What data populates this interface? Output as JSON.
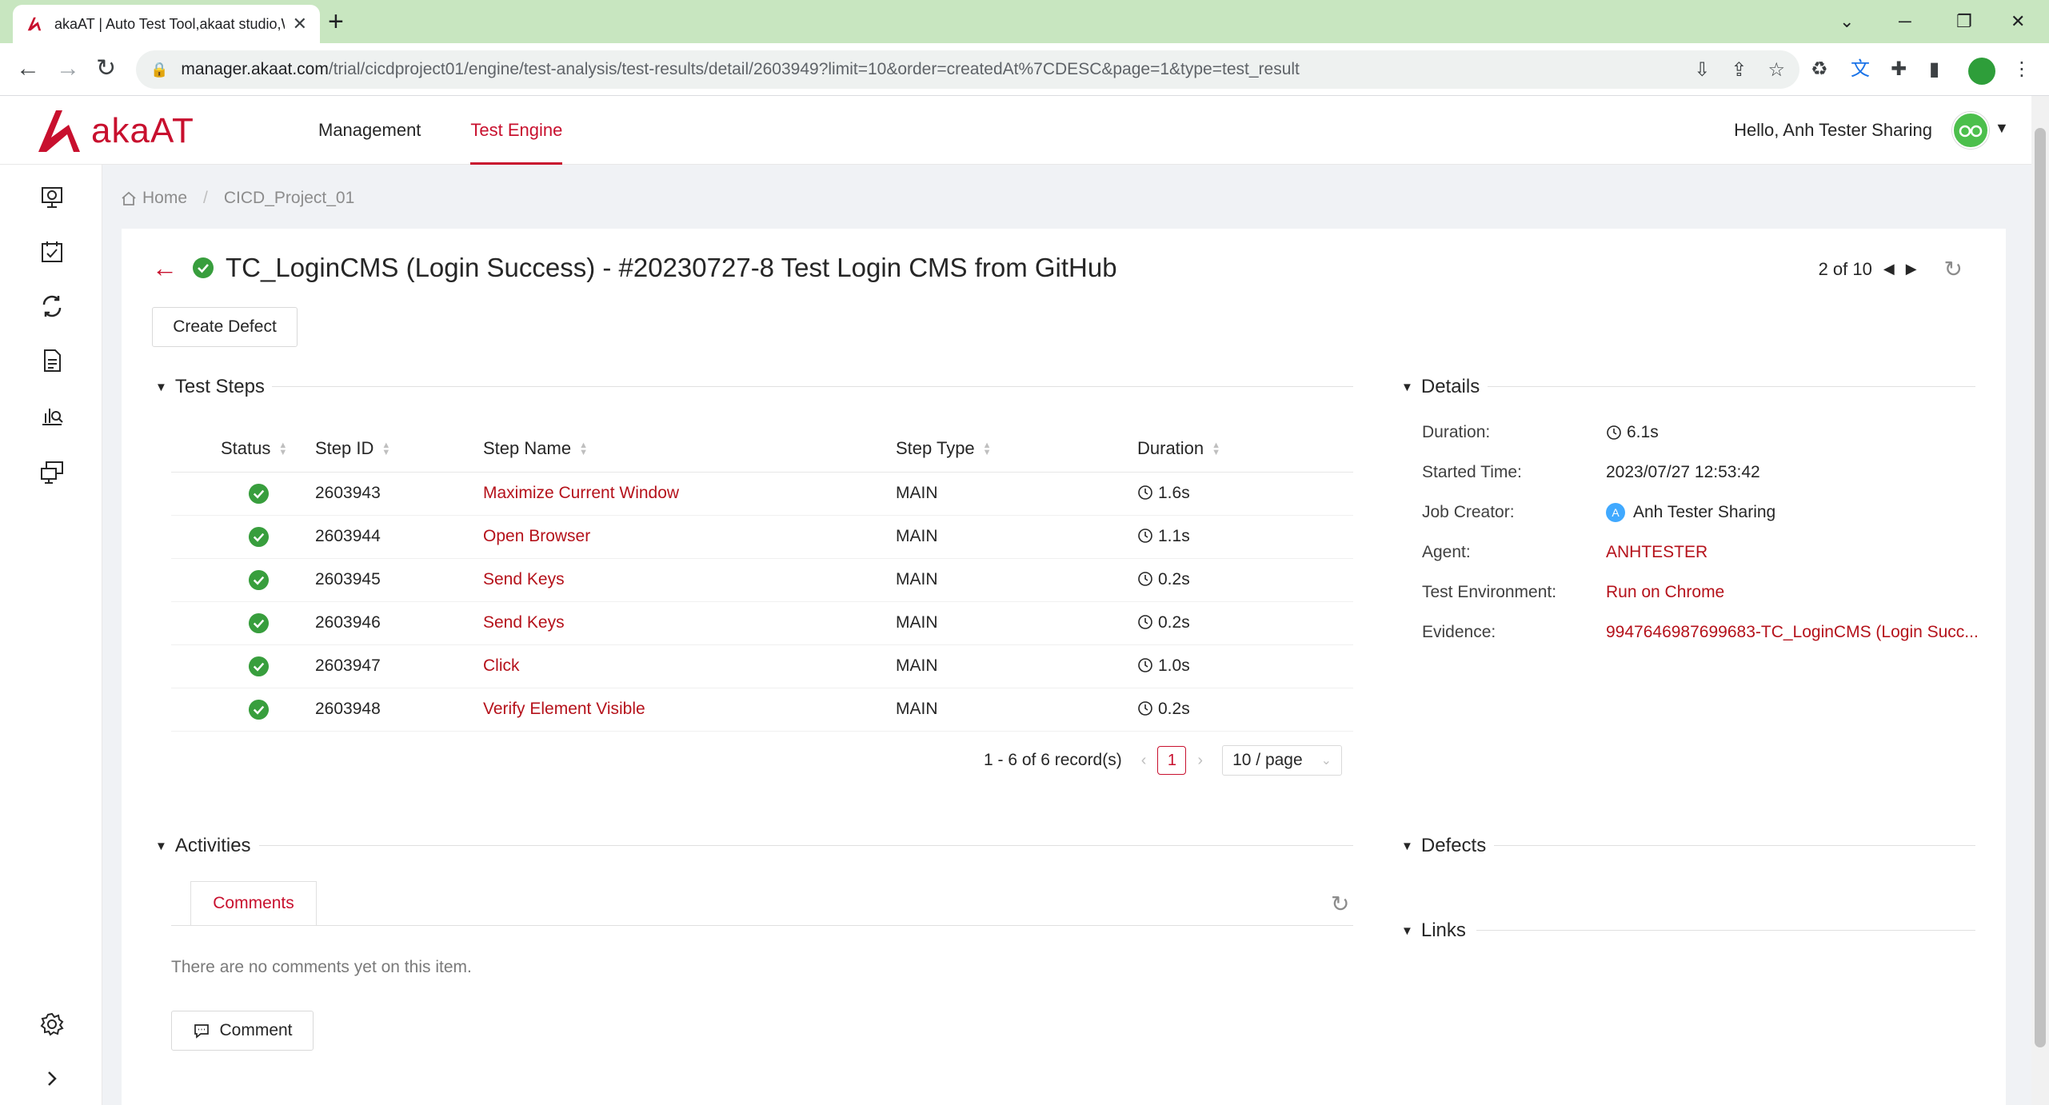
{
  "browser": {
    "tab_title": "akaAT | Auto Test Tool,akaat studio,Web",
    "url_host": "manager.akaat.com",
    "url_path": "/trial/cicdproject01/engine/test-analysis/test-results/detail/2603949?limit=10&order=createdAt%7CDESC&page=1&type=test_result"
  },
  "header": {
    "brand": "akaAT",
    "nav": [
      "Management",
      "Test Engine"
    ],
    "active_nav": "Test Engine",
    "greeting_prefix": "Hello,",
    "user_name": "Anh Tester Sharing"
  },
  "breadcrumb": {
    "home": "Home",
    "project": "CICD_Project_01"
  },
  "page": {
    "title": "TC_LoginCMS (Login Success) - #20230727-8 Test Login CMS from GitHub",
    "position": "2 of 10",
    "create_defect_label": "Create Defect"
  },
  "test_steps": {
    "section_title": "Test Steps",
    "columns": [
      "Status",
      "Step ID",
      "Step Name",
      "Step Type",
      "Duration"
    ],
    "rows": [
      {
        "id": "2603943",
        "name": "Maximize Current Window",
        "type": "MAIN",
        "duration": "1.6s"
      },
      {
        "id": "2603944",
        "name": "Open Browser",
        "type": "MAIN",
        "duration": "1.1s"
      },
      {
        "id": "2603945",
        "name": "Send Keys",
        "type": "MAIN",
        "duration": "0.2s"
      },
      {
        "id": "2603946",
        "name": "Send Keys",
        "type": "MAIN",
        "duration": "0.2s"
      },
      {
        "id": "2603947",
        "name": "Click",
        "type": "MAIN",
        "duration": "1.0s"
      },
      {
        "id": "2603948",
        "name": "Verify Element Visible",
        "type": "MAIN",
        "duration": "0.2s"
      }
    ],
    "pagination": {
      "summary": "1 - 6 of 6 record(s)",
      "current_page": "1",
      "page_size": "10 / page"
    }
  },
  "details": {
    "section_title": "Details",
    "duration_label": "Duration:",
    "duration": "6.1s",
    "started_label": "Started Time:",
    "started": "2023/07/27 12:53:42",
    "creator_label": "Job Creator:",
    "creator_initial": "A",
    "creator": "Anh Tester Sharing",
    "agent_label": "Agent:",
    "agent": "ANHTESTER",
    "env_label": "Test Environment:",
    "env": "Run on Chrome",
    "evidence_label": "Evidence:",
    "evidence": "9947646987699683-TC_LoginCMS (Login Succ..."
  },
  "activities": {
    "section_title": "Activities",
    "tab": "Comments",
    "empty": "There are no comments yet on this item.",
    "comment_button": "Comment"
  },
  "defects": {
    "section_title": "Defects"
  },
  "links": {
    "section_title": "Links"
  },
  "colors": {
    "brand": "#c8102e",
    "success": "#389e3d",
    "link": "#b5121b",
    "chrome_tabbar": "#c8e6c0"
  }
}
